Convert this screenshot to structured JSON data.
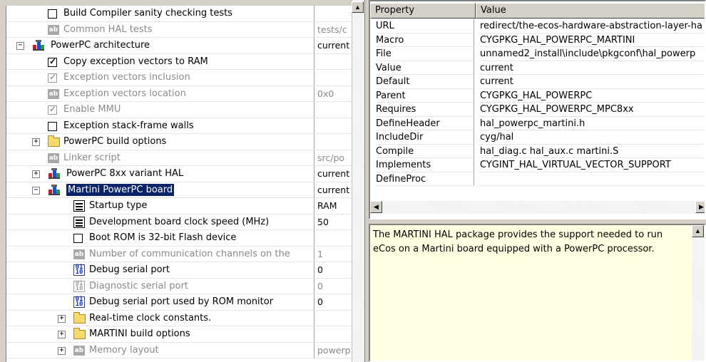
{
  "tree": {
    "rows": [
      {
        "type": "checkbox",
        "indent": 1,
        "label": "Build Compiler sanity checking tests",
        "value": "",
        "checked": false,
        "disabled": false
      },
      {
        "type": "string",
        "indent": 1,
        "label": "Common HAL tests",
        "value": "tests/c",
        "disabled": true
      },
      {
        "type": "package",
        "indent": 0,
        "expander": "−",
        "label": "PowerPC architecture",
        "value": "current",
        "disabled": false
      },
      {
        "type": "checkbox",
        "indent": 1,
        "label": "Copy exception vectors to RAM",
        "value": "",
        "checked": true,
        "disabled": false
      },
      {
        "type": "checkbox",
        "indent": 1,
        "label": "Exception vectors inclusion",
        "value": "",
        "checked": true,
        "disabled": true
      },
      {
        "type": "string",
        "indent": 1,
        "label": "Exception vectors location",
        "value": "0x0",
        "disabled": true
      },
      {
        "type": "checkbox",
        "indent": 1,
        "label": "Enable MMU",
        "value": "",
        "checked": true,
        "disabled": true
      },
      {
        "type": "checkbox",
        "indent": 1,
        "label": "Exception stack-frame walls",
        "value": "",
        "checked": false,
        "disabled": false
      },
      {
        "type": "folder",
        "indent": 1,
        "expander": "+",
        "label": "PowerPC build options",
        "value": "",
        "disabled": false
      },
      {
        "type": "string",
        "indent": 1,
        "label": "Linker script",
        "value": "src/po",
        "disabled": true
      },
      {
        "type": "package",
        "indent": 1,
        "expander": "+",
        "label": "PowerPC 8xx variant HAL",
        "value": "current",
        "disabled": false
      },
      {
        "type": "package",
        "indent": 1,
        "expander": "−",
        "label": "Martini PowerPC board",
        "value": "current",
        "disabled": false,
        "selected": true
      },
      {
        "type": "enum",
        "indent": 2,
        "label": "Startup type",
        "value": "RAM",
        "disabled": false
      },
      {
        "type": "enum",
        "indent": 2,
        "label": "Development board clock speed (MHz)",
        "value": "50",
        "disabled": false
      },
      {
        "type": "checkbox",
        "indent": 2,
        "label": "Boot ROM is 32-bit Flash device",
        "value": "",
        "checked": false,
        "disabled": false
      },
      {
        "type": "string",
        "indent": 2,
        "label": "Number of communication channels on the",
        "value": "1",
        "disabled": true
      },
      {
        "type": "spin",
        "indent": 2,
        "label": "Debug serial port",
        "value": "0",
        "disabled": false
      },
      {
        "type": "spin",
        "indent": 2,
        "label": "Diagnostic serial port",
        "value": "0",
        "disabled": true
      },
      {
        "type": "spin",
        "indent": 2,
        "label": "Debug serial port used by ROM monitor",
        "value": "0",
        "disabled": false
      },
      {
        "type": "folder",
        "indent": 2,
        "expander": "+",
        "label": "Real-time clock constants.",
        "value": "",
        "disabled": false
      },
      {
        "type": "folder",
        "indent": 2,
        "expander": "+",
        "label": "MARTINI build options",
        "value": "",
        "disabled": false
      },
      {
        "type": "string",
        "indent": 2,
        "expander": "+",
        "label": "Memory layout",
        "value": "powerp",
        "disabled": true
      }
    ]
  },
  "properties": {
    "headers": {
      "property": "Property",
      "value": "Value"
    },
    "rows": [
      {
        "key": "URL",
        "value": "redirect/the-ecos-hardware-abstraction-layer-ha"
      },
      {
        "key": "Macro",
        "value": "CYGPKG_HAL_POWERPC_MARTINI"
      },
      {
        "key": "File",
        "value": "unnamed2_install\\include\\pkgconf\\hal_powerp"
      },
      {
        "key": "Value",
        "value": "current"
      },
      {
        "key": "Default",
        "value": "current"
      },
      {
        "key": "Parent",
        "value": "CYGPKG_HAL_POWERPC"
      },
      {
        "key": "Requires",
        "value": "CYGPKG_HAL_POWERPC_MPC8xx"
      },
      {
        "key": "DefineHeader",
        "value": "hal_powerpc_martini.h"
      },
      {
        "key": "IncludeDir",
        "value": "cyg/hal"
      },
      {
        "key": "Compile",
        "value": "hal_diag.c hal_aux.c martini.S"
      },
      {
        "key": "Implements",
        "value": "CYGINT_HAL_VIRTUAL_VECTOR_SUPPORT"
      },
      {
        "key": "DefineProc",
        "value": ""
      }
    ]
  },
  "description": {
    "text": "The MARTINI HAL package provides the support needed to run\neCos on a Martini board equipped with a PowerPC processor."
  },
  "icons": {
    "scroll_up": "▲",
    "scroll_left": "◀",
    "scroll_right": "▶"
  }
}
